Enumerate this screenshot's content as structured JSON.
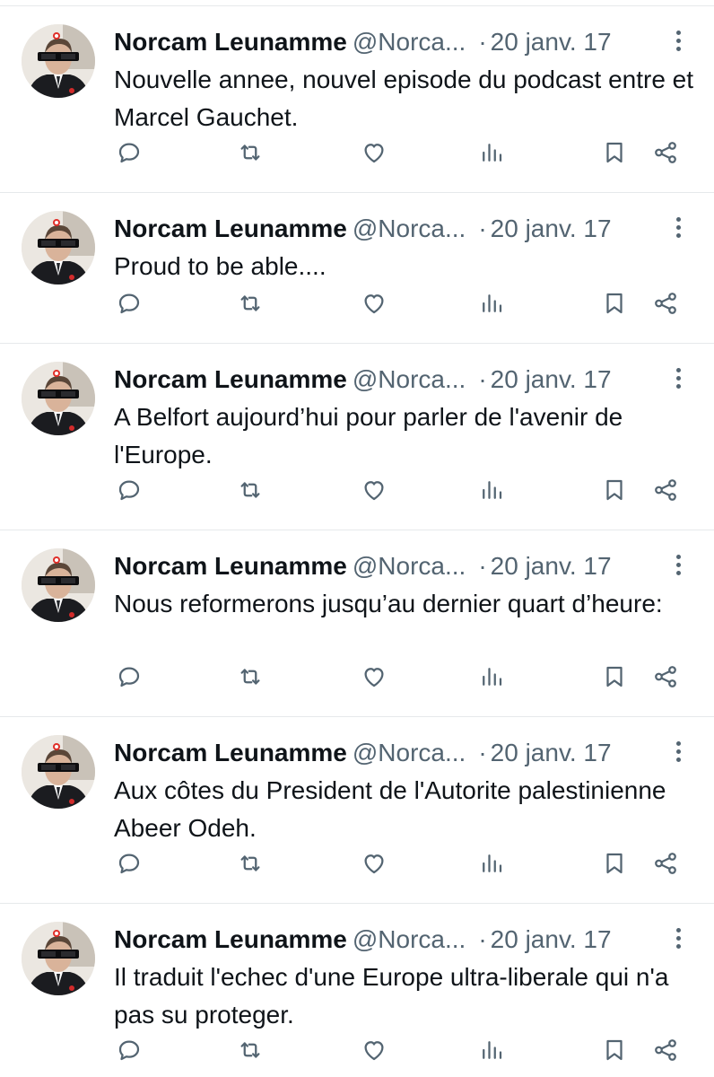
{
  "tweets": [
    {
      "name": "Norcam Leunamme",
      "handle": "@Norca...",
      "separator": "·",
      "date": "20 janv. 17",
      "text": "Nouvelle annee, nouvel episode du podcast entre et Marcel Gauchet."
    },
    {
      "name": "Norcam Leunamme",
      "handle": "@Norca...",
      "separator": "·",
      "date": "20 janv. 17",
      "text": "Proud to be able...."
    },
    {
      "name": "Norcam Leunamme",
      "handle": "@Norca...",
      "separator": "·",
      "date": "20 janv. 17",
      "text": "A Belfort aujourd’hui pour parler de l'avenir de l'Europe."
    },
    {
      "name": "Norcam Leunamme",
      "handle": "@Norca...",
      "separator": "·",
      "date": "20 janv. 17",
      "text": "Nous reformerons jusqu’au dernier quart d’heure:"
    },
    {
      "name": "Norcam Leunamme",
      "handle": "@Norca...",
      "separator": "·",
      "date": "20 janv. 17",
      "text": "Aux côtes du President de l'Autorite palestinienne Abeer Odeh."
    },
    {
      "name": "Norcam Leunamme",
      "handle": "@Norca...",
      "separator": "·",
      "date": "20 janv. 17",
      "text": "Il traduit l'echec d'une Europe ultra-liberale qui n'a pas su proteger."
    }
  ],
  "icons": {
    "reply": "reply-icon",
    "retweet": "retweet-icon",
    "like": "like-icon",
    "views": "views-icon",
    "bookmark": "bookmark-icon",
    "share": "share-icon",
    "more": "more-icon"
  },
  "colors": {
    "text": "#0f1419",
    "secondary": "#536471",
    "divider": "#e6e9eb",
    "background": "#ffffff"
  }
}
